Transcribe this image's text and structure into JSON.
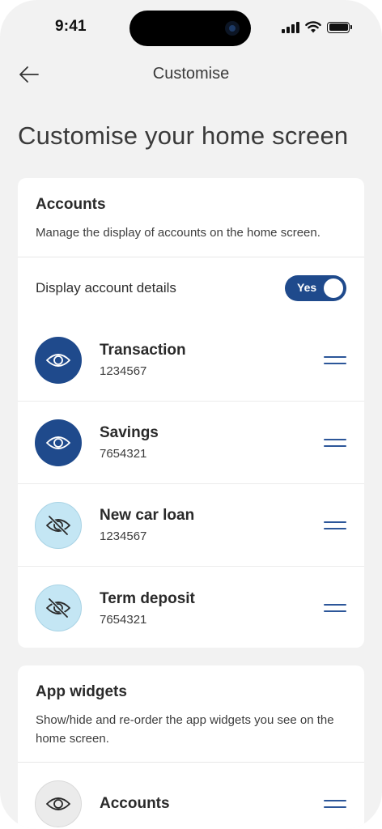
{
  "status_bar": {
    "time": "9:41"
  },
  "nav": {
    "title": "Customise"
  },
  "page": {
    "title": "Customise your home screen"
  },
  "accounts_card": {
    "title": "Accounts",
    "description": "Manage the display of accounts on the home screen.",
    "toggle": {
      "label": "Display account details",
      "value": "Yes"
    },
    "items": [
      {
        "name": "Transaction",
        "number": "1234567",
        "visible": true
      },
      {
        "name": "Savings",
        "number": "7654321",
        "visible": true
      },
      {
        "name": "New car loan",
        "number": "1234567",
        "visible": false
      },
      {
        "name": "Term deposit",
        "number": "7654321",
        "visible": false
      }
    ]
  },
  "widgets_card": {
    "title": "App widgets",
    "description": "Show/hide and re-order the app widgets you see on the home screen.",
    "items": [
      {
        "name": "Accounts"
      }
    ]
  },
  "colors": {
    "accent": "#1f4a8c",
    "hidden_icon_bg": "#c4e6f4",
    "background": "#f2f2f2",
    "card": "#ffffff"
  },
  "icons": {
    "back": "arrow-left-icon",
    "visible": "eye-icon",
    "hidden": "eye-off-icon",
    "reorder": "drag-handle-icon"
  }
}
